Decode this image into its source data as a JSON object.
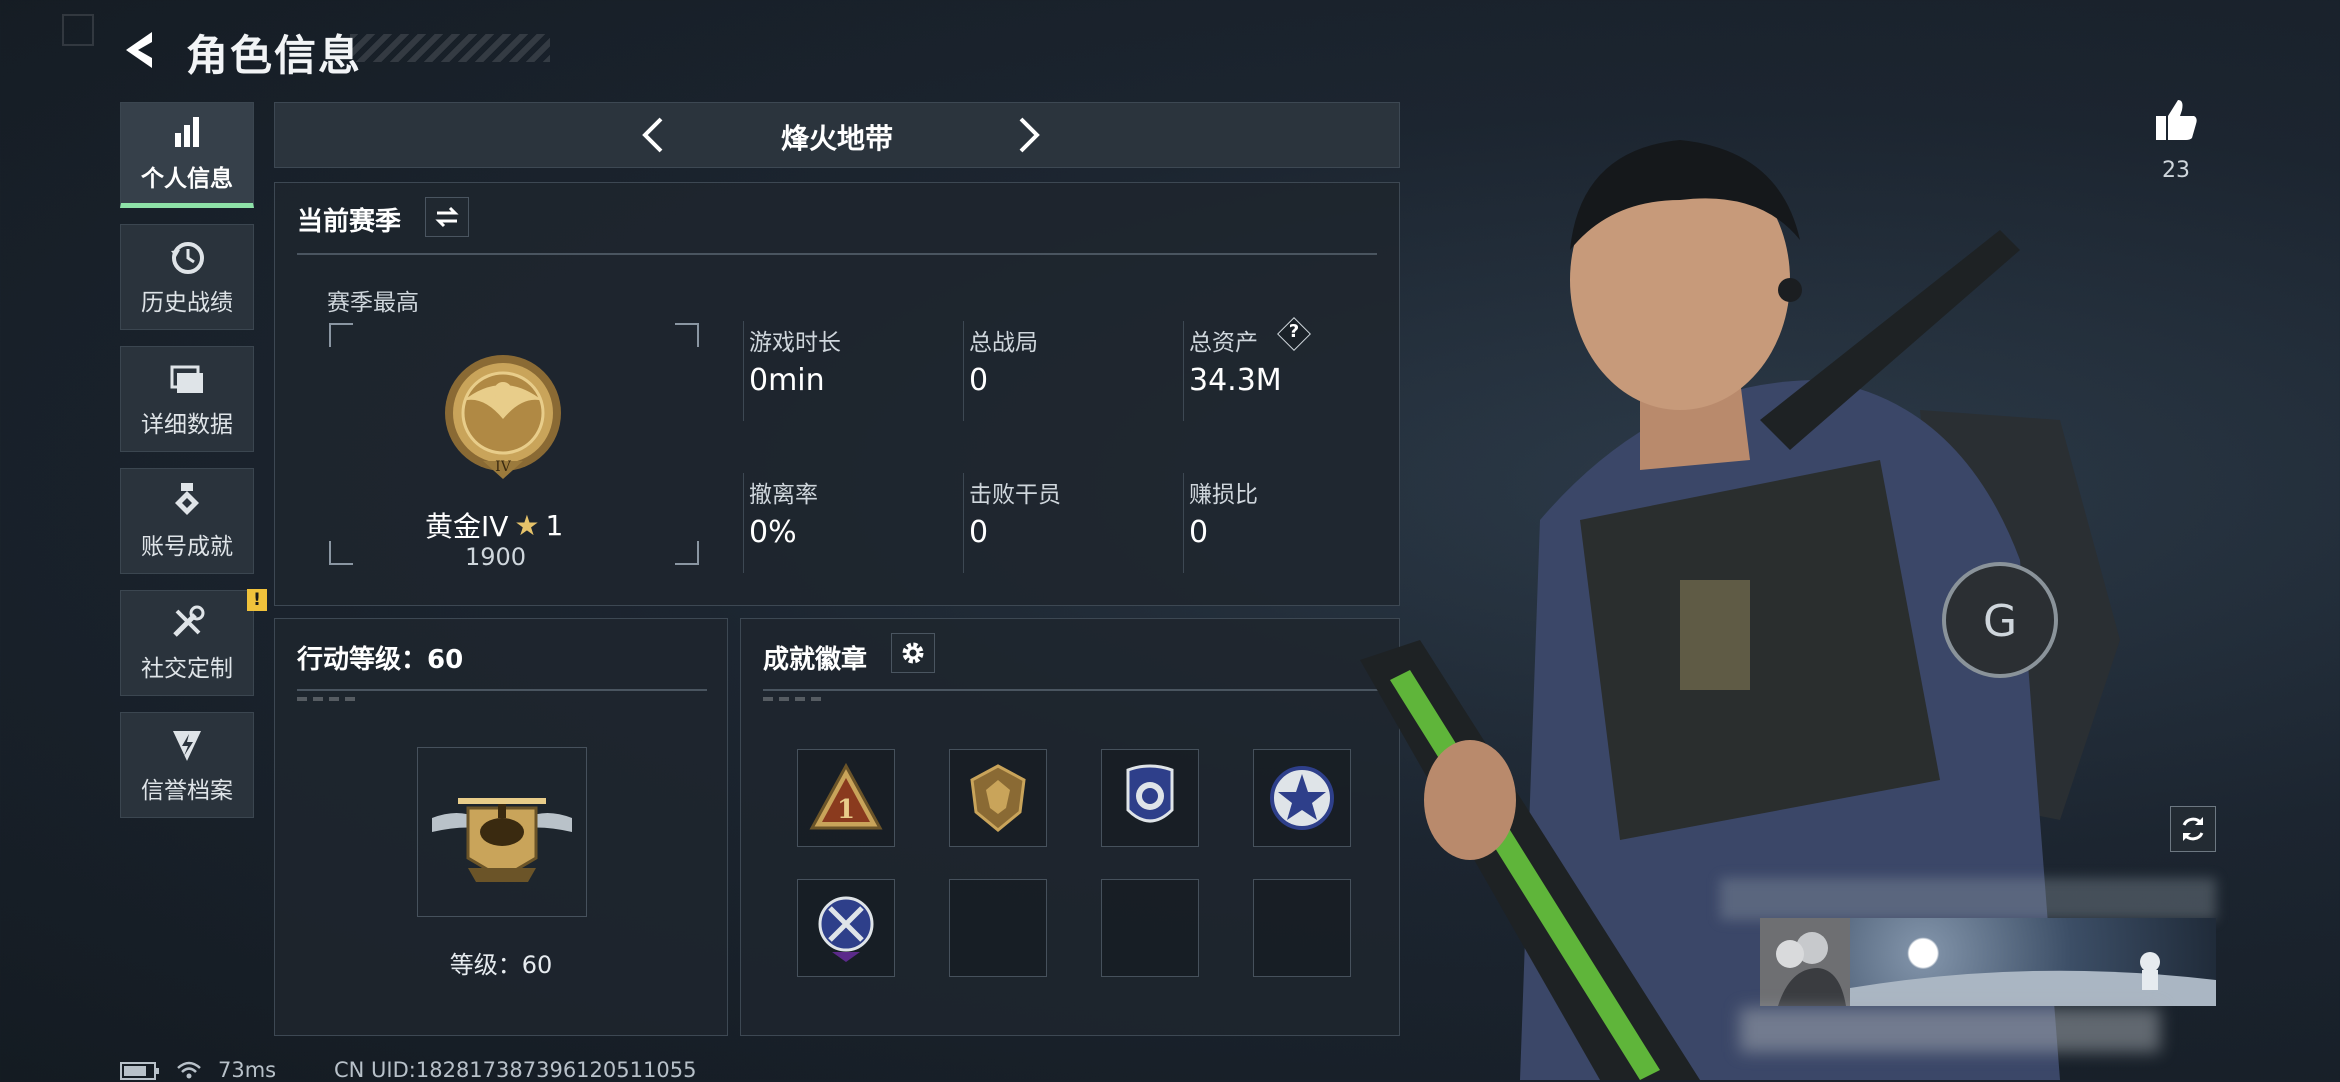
{
  "header": {
    "title": "角色信息"
  },
  "sidebar": {
    "items": [
      {
        "label": "个人信息",
        "icon": "bar-chart-icon",
        "active": true
      },
      {
        "label": "历史战绩",
        "icon": "clock-history-icon"
      },
      {
        "label": "详细数据",
        "icon": "folder-icon"
      },
      {
        "label": "账号成就",
        "icon": "medal-icon"
      },
      {
        "label": "社交定制",
        "icon": "tools-icon",
        "badge": "!"
      },
      {
        "label": "信誉档案",
        "icon": "shield-lightning-icon"
      }
    ]
  },
  "mode": {
    "title": "烽火地带"
  },
  "season": {
    "title": "当前赛季",
    "best_label": "赛季最高",
    "rank_name": "黄金IV",
    "rank_stars": "1",
    "rank_score": "1900",
    "rank_emblem_text": "IV",
    "stats": [
      {
        "label": "游戏时长",
        "value": "0min"
      },
      {
        "label": "总战局",
        "value": "0"
      },
      {
        "label": "总资产",
        "value": "34.3M",
        "help": "?"
      },
      {
        "label": "撤离率",
        "value": "0%"
      },
      {
        "label": "击败干员",
        "value": "0"
      },
      {
        "label": "赚损比",
        "value": "0"
      }
    ]
  },
  "level": {
    "title": "行动等级：60",
    "level_label": "等级：60"
  },
  "achievements": {
    "title": "成就徽章",
    "badges": [
      "triangle-1-badge",
      "crest-badge",
      "police-badge",
      "star-badge",
      "cross-badge",
      "",
      "",
      ""
    ]
  },
  "likes": {
    "count": "23"
  },
  "footer": {
    "ping": "73ms",
    "uid": "CN UID:18281738739612051105​5"
  },
  "colors": {
    "accent": "#8ee2a8",
    "warning": "#f0c23b",
    "panel": "#1e262e",
    "gold": "#c9a45a"
  }
}
